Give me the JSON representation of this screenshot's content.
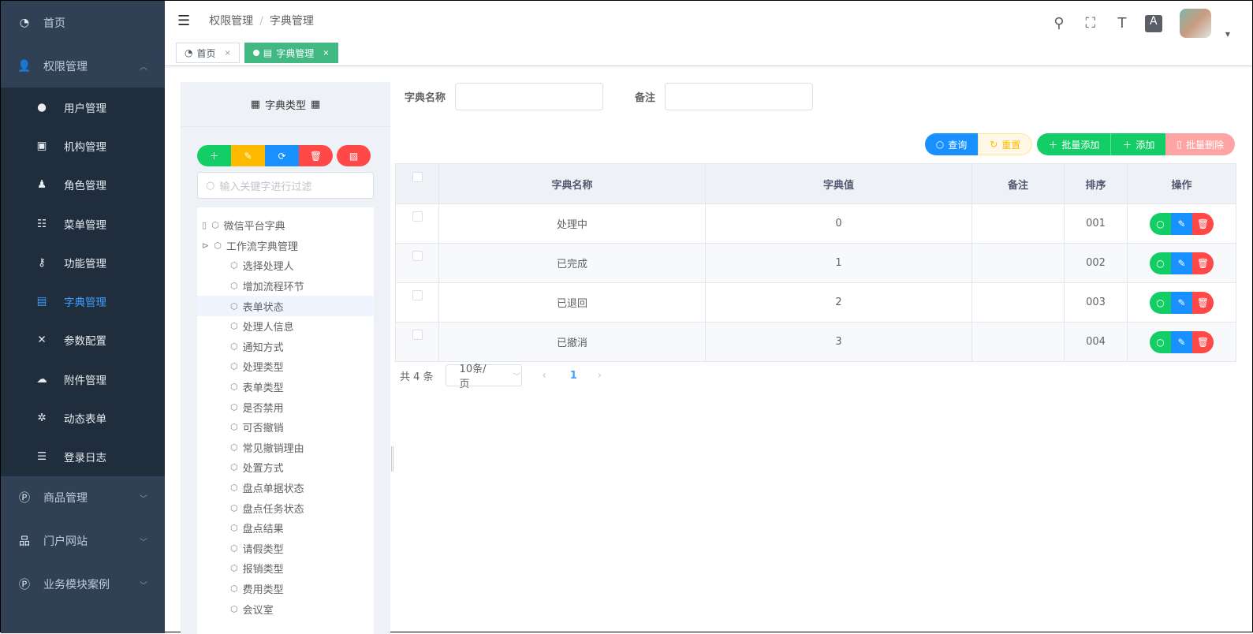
{
  "sidebar": {
    "home": "首页",
    "groups": [
      {
        "label": "权限管理",
        "expanded": true
      },
      {
        "label": "商品管理"
      },
      {
        "label": "门户网站"
      },
      {
        "label": "业务模块案例"
      }
    ],
    "sub": [
      "用户管理",
      "机构管理",
      "角色管理",
      "菜单管理",
      "功能管理",
      "字典管理",
      "参数配置",
      "附件管理",
      "动态表单",
      "登录日志"
    ],
    "active": "字典管理"
  },
  "header": {
    "breadcrumb": [
      "权限管理",
      "字典管理"
    ]
  },
  "tabs": [
    {
      "label": "首页"
    },
    {
      "label": "字典管理",
      "active": true
    }
  ],
  "tree": {
    "title": "字典类型",
    "search_placeholder": "输入关键字进行过滤",
    "roots": [
      "微信平台字典",
      "工作流字典管理"
    ],
    "children": [
      "选择处理人",
      "增加流程环节",
      "表单状态",
      "处理人信息",
      "通知方式",
      "处理类型",
      "表单类型",
      "是否禁用",
      "可否撤销",
      "常见撤销理由",
      "处置方式",
      "盘点单据状态",
      "盘点任务状态",
      "盘点结果",
      "请假类型",
      "报销类型",
      "费用类型",
      "会议室"
    ],
    "selected": "表单状态"
  },
  "filters": {
    "name_label": "字典名称",
    "name_value": "",
    "remark_label": "备注",
    "remark_value": ""
  },
  "toolbar": {
    "query": "查询",
    "reset": "重置",
    "batch_add": "批量添加",
    "add": "添加",
    "batch_delete": "批量删除"
  },
  "table": {
    "headers": [
      "字典名称",
      "字典值",
      "备注",
      "排序",
      "操作"
    ],
    "rows": [
      {
        "name": "处理中",
        "value": "0",
        "remark": "",
        "sort": "001"
      },
      {
        "name": "已完成",
        "value": "1",
        "remark": "",
        "sort": "002"
      },
      {
        "name": "已退回",
        "value": "2",
        "remark": "",
        "sort": "003"
      },
      {
        "name": "已撤消",
        "value": "3",
        "remark": "",
        "sort": "004"
      }
    ]
  },
  "pager": {
    "total": "共 4 条",
    "page_size": "10条/页",
    "current": "1"
  },
  "colors": {
    "sidebar": "#304156",
    "submenu": "#1f2d3d",
    "active": "#409eff",
    "tab": "#42b983",
    "green": "#13ce66",
    "blue": "#1890ff",
    "red": "#ff4949",
    "yellow": "#ffba00"
  }
}
